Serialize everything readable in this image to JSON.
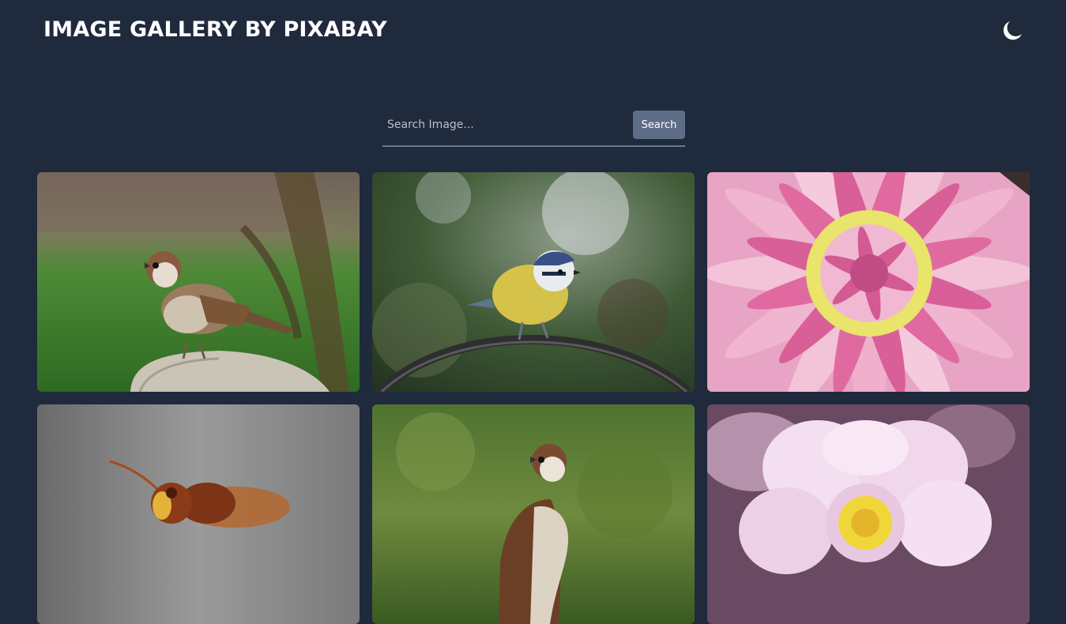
{
  "header": {
    "title": "IMAGE GALLERY BY PIXABAY",
    "theme_icon": "moon-icon"
  },
  "search": {
    "placeholder": "Search Image...",
    "value": "",
    "button_label": "Search"
  },
  "gallery": {
    "images": [
      {
        "subject": "sparrow-on-rock"
      },
      {
        "subject": "blue-tit-on-arch"
      },
      {
        "subject": "pink-dahlia"
      },
      {
        "subject": "hornet"
      },
      {
        "subject": "sparrow-on-grass"
      },
      {
        "subject": "pink-anemone"
      }
    ]
  },
  "colors": {
    "background": "#1f2a3d",
    "button": "#5e6e87",
    "text": "#ffffff"
  }
}
